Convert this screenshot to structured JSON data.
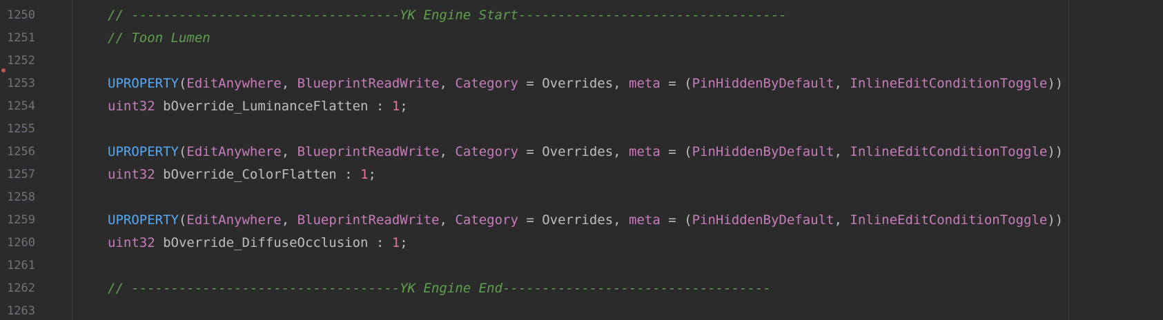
{
  "editor": {
    "lines": [
      {
        "number": "1250",
        "tokens": [
          {
            "t": "comment",
            "v": "// ----------------------------------YK Engine Start----------------------------------"
          }
        ]
      },
      {
        "number": "1251",
        "tokens": [
          {
            "t": "comment",
            "v": "// Toon Lumen"
          }
        ]
      },
      {
        "number": "1252",
        "tokens": []
      },
      {
        "number": "1253",
        "tokens": [
          {
            "t": "macro",
            "v": "UPROPERTY"
          },
          {
            "t": "plain",
            "v": "("
          },
          {
            "t": "param",
            "v": "EditAnywhere"
          },
          {
            "t": "plain",
            "v": ", "
          },
          {
            "t": "param",
            "v": "BlueprintReadWrite"
          },
          {
            "t": "plain",
            "v": ", "
          },
          {
            "t": "param",
            "v": "Category"
          },
          {
            "t": "plain",
            "v": " = Overrides, "
          },
          {
            "t": "param",
            "v": "meta"
          },
          {
            "t": "plain",
            "v": " = ("
          },
          {
            "t": "param",
            "v": "PinHiddenByDefault"
          },
          {
            "t": "plain",
            "v": ", "
          },
          {
            "t": "param",
            "v": "InlineEditConditionToggle"
          },
          {
            "t": "plain",
            "v": "))"
          }
        ]
      },
      {
        "number": "1254",
        "tokens": [
          {
            "t": "kw",
            "v": "uint32"
          },
          {
            "t": "plain",
            "v": " bOverride_LuminanceFlatten : "
          },
          {
            "t": "num",
            "v": "1"
          },
          {
            "t": "plain",
            "v": ";"
          }
        ]
      },
      {
        "number": "1255",
        "tokens": []
      },
      {
        "number": "1256",
        "tokens": [
          {
            "t": "macro",
            "v": "UPROPERTY"
          },
          {
            "t": "plain",
            "v": "("
          },
          {
            "t": "param",
            "v": "EditAnywhere"
          },
          {
            "t": "plain",
            "v": ", "
          },
          {
            "t": "param",
            "v": "BlueprintReadWrite"
          },
          {
            "t": "plain",
            "v": ", "
          },
          {
            "t": "param",
            "v": "Category"
          },
          {
            "t": "plain",
            "v": " = Overrides, "
          },
          {
            "t": "param",
            "v": "meta"
          },
          {
            "t": "plain",
            "v": " = ("
          },
          {
            "t": "param",
            "v": "PinHiddenByDefault"
          },
          {
            "t": "plain",
            "v": ", "
          },
          {
            "t": "param",
            "v": "InlineEditConditionToggle"
          },
          {
            "t": "plain",
            "v": "))"
          }
        ]
      },
      {
        "number": "1257",
        "tokens": [
          {
            "t": "kw",
            "v": "uint32"
          },
          {
            "t": "plain",
            "v": " bOverride_ColorFlatten : "
          },
          {
            "t": "num",
            "v": "1"
          },
          {
            "t": "plain",
            "v": ";"
          }
        ]
      },
      {
        "number": "1258",
        "tokens": []
      },
      {
        "number": "1259",
        "tokens": [
          {
            "t": "macro",
            "v": "UPROPERTY"
          },
          {
            "t": "plain",
            "v": "("
          },
          {
            "t": "param",
            "v": "EditAnywhere"
          },
          {
            "t": "plain",
            "v": ", "
          },
          {
            "t": "param",
            "v": "BlueprintReadWrite"
          },
          {
            "t": "plain",
            "v": ", "
          },
          {
            "t": "param",
            "v": "Category"
          },
          {
            "t": "plain",
            "v": " = Overrides, "
          },
          {
            "t": "param",
            "v": "meta"
          },
          {
            "t": "plain",
            "v": " = ("
          },
          {
            "t": "param",
            "v": "PinHiddenByDefault"
          },
          {
            "t": "plain",
            "v": ", "
          },
          {
            "t": "param",
            "v": "InlineEditConditionToggle"
          },
          {
            "t": "plain",
            "v": "))"
          }
        ]
      },
      {
        "number": "1260",
        "tokens": [
          {
            "t": "kw",
            "v": "uint32"
          },
          {
            "t": "plain",
            "v": " bOverride_DiffuseOcclusion : "
          },
          {
            "t": "num",
            "v": "1"
          },
          {
            "t": "plain",
            "v": ";"
          }
        ]
      },
      {
        "number": "1261",
        "tokens": []
      },
      {
        "number": "1262",
        "tokens": [
          {
            "t": "comment",
            "v": "// ----------------------------------YK Engine End----------------------------------"
          }
        ]
      },
      {
        "number": "1263",
        "tokens": []
      }
    ]
  },
  "colors": {
    "background": "#2b2b2b",
    "comment": "#5fa04e",
    "macro": "#56a8f5",
    "param": "#c77dbb",
    "plain": "#bcbec4",
    "number": "#e8739e",
    "line_number": "#6f737a",
    "breakpoint_marker": "#c75450"
  }
}
